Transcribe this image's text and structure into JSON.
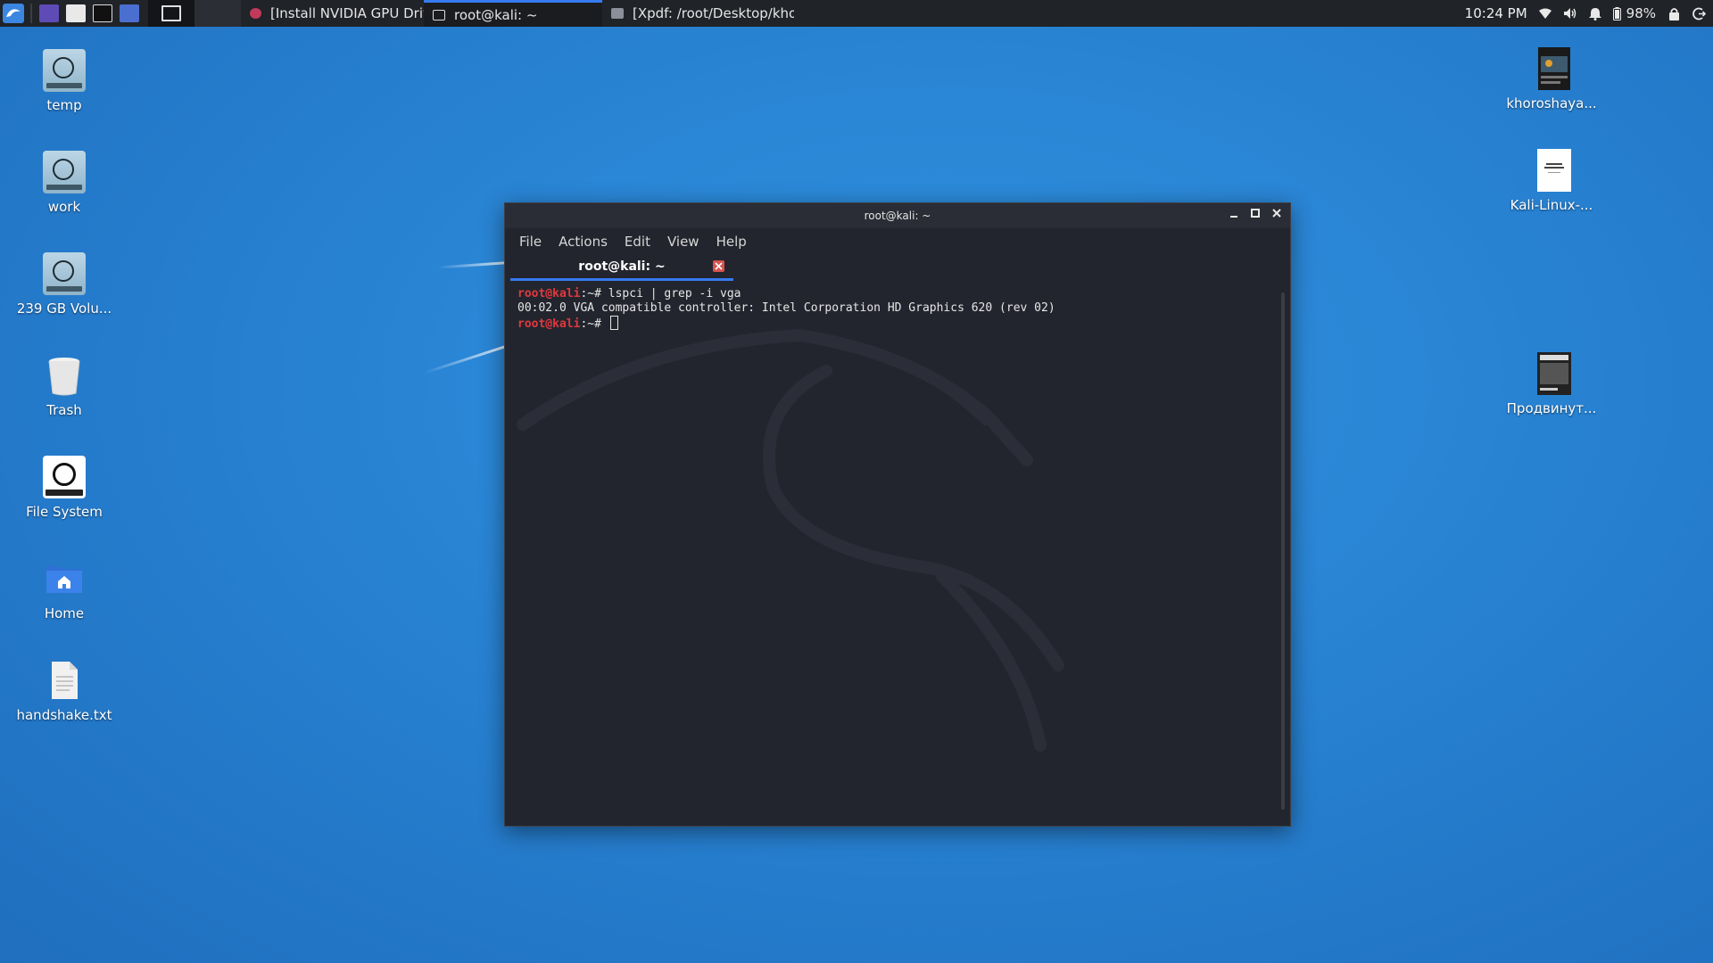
{
  "taskbar": {
    "tasks": [
      {
        "label": "[Install NVIDIA GPU Driv...",
        "active": false
      },
      {
        "label": "root@kali: ~",
        "active": true
      },
      {
        "label": "[Xpdf: /root/Desktop/kho...",
        "active": false
      }
    ],
    "time": "10:24 PM",
    "battery": "98%"
  },
  "desktop": {
    "left_icons": [
      {
        "label": "temp"
      },
      {
        "label": "work"
      },
      {
        "label": "239 GB Volu..."
      },
      {
        "label": "Trash"
      },
      {
        "label": "File System"
      },
      {
        "label": "Home"
      },
      {
        "label": "handshake.txt"
      }
    ],
    "right_icons": [
      {
        "label": "khoroshaya..."
      },
      {
        "label": "Kali-Linux-..."
      },
      {
        "label": "Продвинут..."
      }
    ]
  },
  "terminal": {
    "window_title": "root@kali: ~",
    "menu": [
      "File",
      "Actions",
      "Edit",
      "View",
      "Help"
    ],
    "tab_label": "root@kali: ~",
    "lines": [
      {
        "user": "root@kali",
        "path": ":~# ",
        "command": "lspci | grep -i vga"
      },
      {
        "output": "00:02.0 VGA compatible controller: Intel Corporation HD Graphics 620 (rev 02)"
      },
      {
        "user": "root@kali",
        "path": ":~# ",
        "command": ""
      }
    ]
  },
  "colors": {
    "accent": "#367bf0",
    "prompt": "#e0393e",
    "terminal_bg": "#23252e",
    "taskbar_bg": "#202328"
  }
}
